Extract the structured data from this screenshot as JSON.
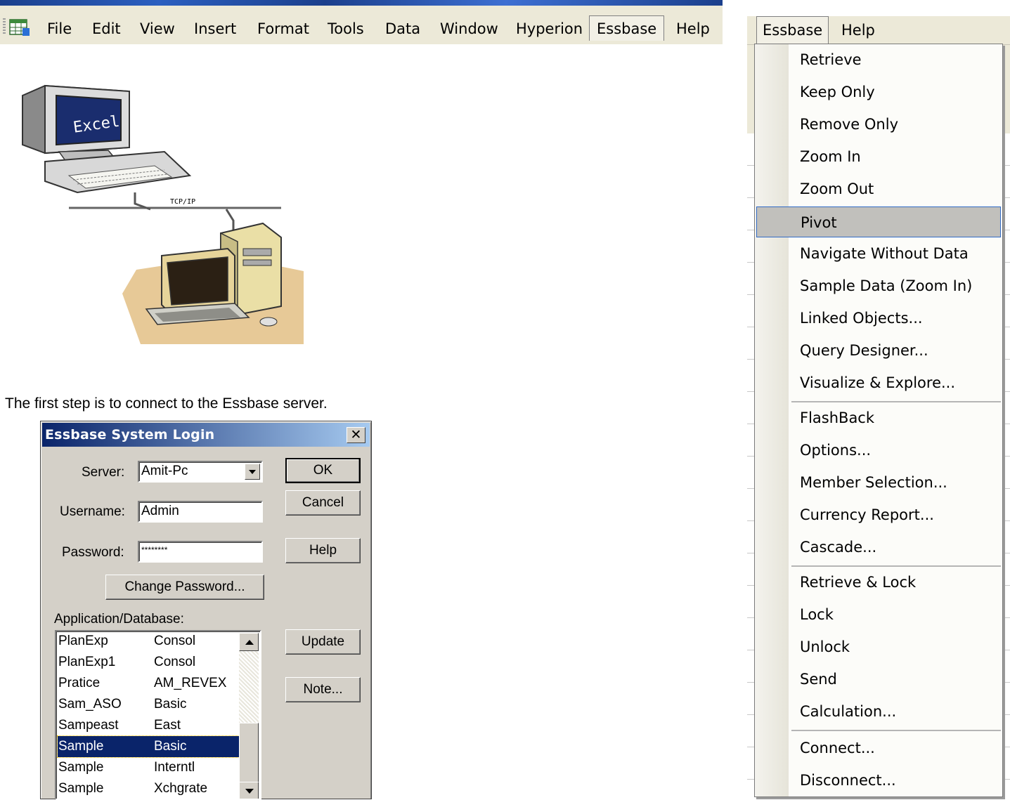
{
  "menubar": {
    "items": [
      "File",
      "Edit",
      "View",
      "Insert",
      "Format",
      "Tools",
      "Data",
      "Window",
      "Hyperion",
      "Essbase",
      "Help"
    ],
    "open_item": "Essbase"
  },
  "illustration": {
    "monitor_text": "Excel",
    "network_label": "TCP/IP"
  },
  "caption": "The first step is to connect to the Essbase server.",
  "login": {
    "title": "Essbase System Login",
    "close_glyph": "✕",
    "server_label": "Server:",
    "server_value": "Amit-Pc",
    "username_label": "Username:",
    "username_value": "Admin",
    "password_label": "Password:",
    "password_value": "********",
    "change_password_label": "Change Password...",
    "app_db_label": "Application/Database:",
    "buttons": {
      "ok": "OK",
      "cancel": "Cancel",
      "help": "Help",
      "update": "Update",
      "note": "Note..."
    },
    "app_list": [
      {
        "app": "PlanExp",
        "db": "Consol",
        "selected": false
      },
      {
        "app": "PlanExp1",
        "db": "Consol",
        "selected": false
      },
      {
        "app": "Pratice",
        "db": "AM_REVEX",
        "selected": false
      },
      {
        "app": "Sam_ASO",
        "db": "Basic",
        "selected": false
      },
      {
        "app": "Sampeast",
        "db": "East",
        "selected": false
      },
      {
        "app": "Sample",
        "db": "Basic",
        "selected": true
      },
      {
        "app": "Sample",
        "db": "Interntl",
        "selected": false
      },
      {
        "app": "Sample",
        "db": "Xchgrate",
        "selected": false
      }
    ]
  },
  "essbase_menu": {
    "menubar": [
      "Essbase",
      "Help"
    ],
    "items": [
      "Retrieve",
      "Keep Only",
      "Remove Only",
      "Zoom In",
      "Zoom Out",
      "Pivot",
      "Navigate Without Data",
      "Sample Data (Zoom In)",
      "Linked Objects...",
      "Query Designer...",
      "Visualize & Explore...",
      "FlashBack",
      "Options...",
      "Member Selection...",
      "Currency Report...",
      "Cascade...",
      "Retrieve & Lock",
      "Lock",
      "Unlock",
      "Send",
      "Calculation...",
      "Connect...",
      "Disconnect..."
    ],
    "highlighted": "Pivot"
  },
  "colors": {
    "selection": "#0a246a",
    "dialog_face": "#d4d0c8",
    "menu_highlight_border": "#316ac5"
  }
}
